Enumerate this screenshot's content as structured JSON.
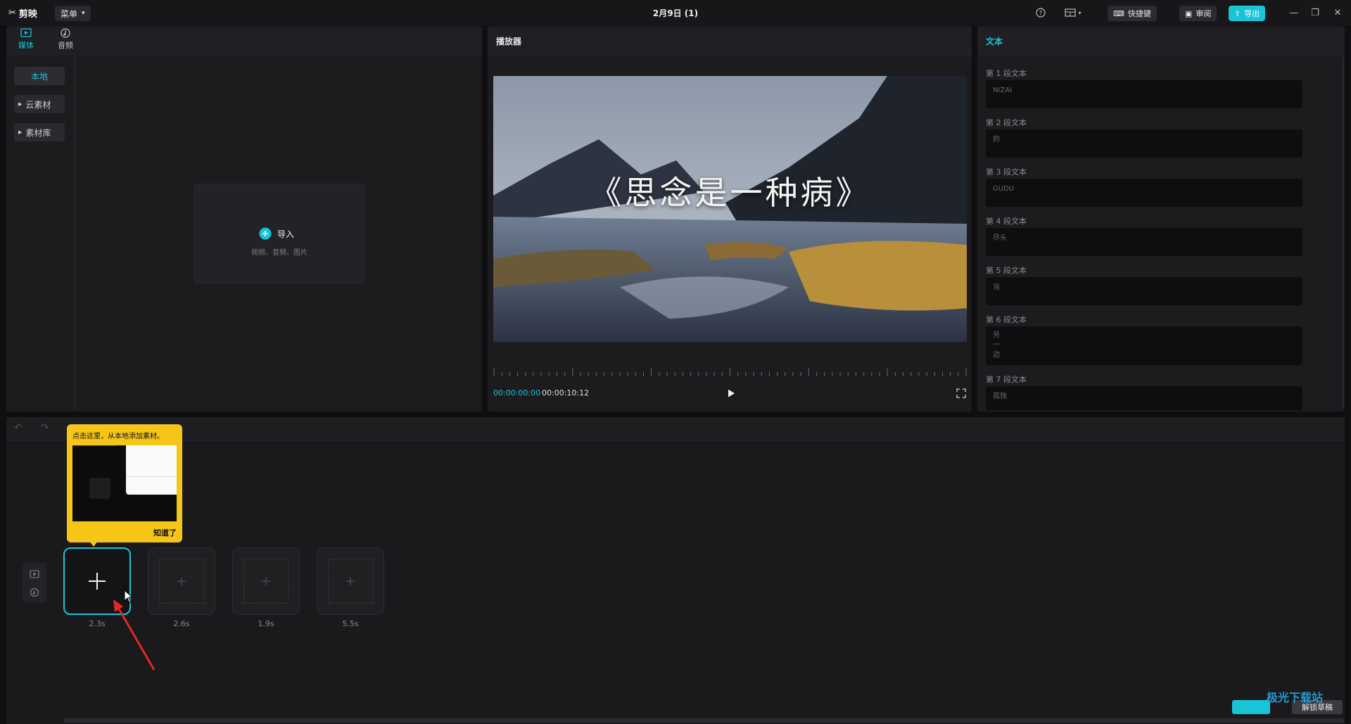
{
  "app": {
    "name": "剪映",
    "menu_label": "菜单",
    "window_title": "2月9日 (1)"
  },
  "toolbar": {
    "shortcut_label": "快捷键",
    "review_label": "审阅",
    "export_label": "导出"
  },
  "media_panel": {
    "tabs": [
      {
        "label": "媒体",
        "icon": "media-icon",
        "active": true
      },
      {
        "label": "音频",
        "icon": "audio-icon",
        "active": false
      }
    ],
    "sidebar": [
      {
        "label": "本地",
        "active": true
      },
      {
        "label": "云素材"
      },
      {
        "label": "素材库"
      }
    ],
    "import": {
      "label": "导入",
      "hint": "视频、音频、图片"
    }
  },
  "player": {
    "title": "播放器",
    "overlay_text": "《思念是一种病》",
    "current_time": "00:00:00:00",
    "total_time": "00:00:10:12"
  },
  "text_panel": {
    "title": "文本",
    "segments": [
      {
        "label": "第 1 段文本",
        "value": "NIZAI"
      },
      {
        "label": "第 2 段文本",
        "value": "的"
      },
      {
        "label": "第 3 段文本",
        "value": "GUDU"
      },
      {
        "label": "第 4 段文本",
        "value": "尽头"
      },
      {
        "label": "第 5 段文本",
        "value": "当"
      },
      {
        "label": "第 6 段文本",
        "lines": [
          "另",
          "一",
          "边"
        ]
      },
      {
        "label": "第 7 段文本",
        "value": "孤独"
      }
    ]
  },
  "timeline": {
    "tooltip": {
      "text": "点击这里，从本地添加素材。",
      "confirm": "知道了"
    },
    "slots": [
      {
        "duration": "2.3s",
        "active": true
      },
      {
        "duration": "2.6s"
      },
      {
        "duration": "1.9s"
      },
      {
        "duration": "5.5s"
      }
    ]
  },
  "footer": {
    "unlock_label": "解锁草稿",
    "watermark": "极光下载站"
  },
  "colors": {
    "accent": "#19c4d6",
    "tooltip": "#f5c518",
    "arrow": "#e02828"
  }
}
